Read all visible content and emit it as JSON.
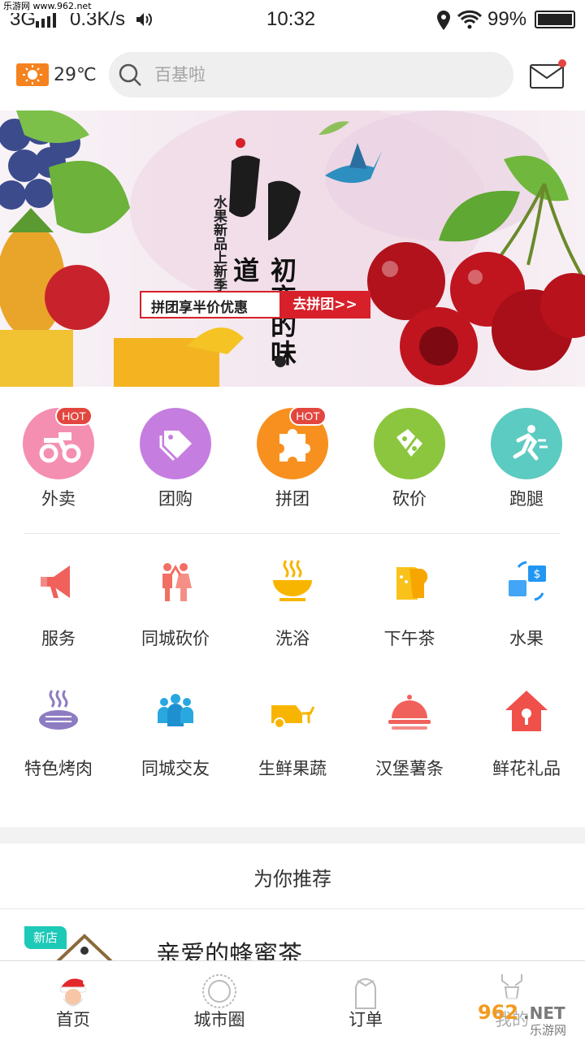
{
  "watermark": {
    "top": "乐游网 www.962.net",
    "bottom_logo": "962.NET",
    "bottom_text": "乐游网"
  },
  "status_bar": {
    "network": "3G",
    "speed": "0.3K/s",
    "time": "10:32",
    "battery": "99%"
  },
  "header": {
    "temperature": "29℃",
    "search_placeholder": "百基啦",
    "mail_unread": true
  },
  "banner": {
    "vertical_text": "水果新品上新季",
    "headline": "初恋的味道",
    "cta_left": "拼团享半价优惠",
    "cta_right": "去拼团>>",
    "slide_count": 1,
    "active_slide": 1
  },
  "categories_row1": [
    {
      "label": "外卖",
      "icon": "scooter-icon",
      "color": "#f48fb1",
      "hot": "HOT"
    },
    {
      "label": "团购",
      "icon": "tag-icon",
      "color": "#c57ee0",
      "hot": ""
    },
    {
      "label": "拼团",
      "icon": "puzzle-icon",
      "color": "#f7901e",
      "hot": "HOT"
    },
    {
      "label": "砍价",
      "icon": "discount-icon",
      "color": "#8cc63f",
      "hot": ""
    },
    {
      "label": "跑腿",
      "icon": "runner-icon",
      "color": "#5ccbc1",
      "hot": ""
    }
  ],
  "categories_row2": [
    {
      "label": "服务",
      "icon": "megaphone-icon"
    },
    {
      "label": "同城砍价",
      "icon": "couple-icon"
    },
    {
      "label": "洗浴",
      "icon": "bath-icon"
    },
    {
      "label": "下午茶",
      "icon": "toast-icon"
    },
    {
      "label": "水果",
      "icon": "exchange-icon"
    }
  ],
  "categories_row3": [
    {
      "label": "特色烤肉",
      "icon": "grill-icon"
    },
    {
      "label": "同城交友",
      "icon": "people-icon"
    },
    {
      "label": "生鲜果蔬",
      "icon": "truck-icon"
    },
    {
      "label": "汉堡薯条",
      "icon": "cloche-icon"
    },
    {
      "label": "鲜花礼品",
      "icon": "gift-house-icon"
    }
  ],
  "recommend": {
    "title": "为你推荐",
    "badge": "新店",
    "shop_name": "亲爱的蜂蜜茶"
  },
  "tabbar": [
    {
      "label": "首页",
      "icon": "santa-icon",
      "active": true
    },
    {
      "label": "城市圈",
      "icon": "circle-badge-icon",
      "active": false
    },
    {
      "label": "订单",
      "icon": "bell-icon",
      "active": false
    },
    {
      "label": "我的",
      "icon": "reindeer-icon",
      "active": false
    }
  ],
  "colors": {
    "accent_red": "#d7202a",
    "hot_badge": "#e3463f",
    "new_badge": "#1dc9b7",
    "sun": "#f5821f"
  }
}
